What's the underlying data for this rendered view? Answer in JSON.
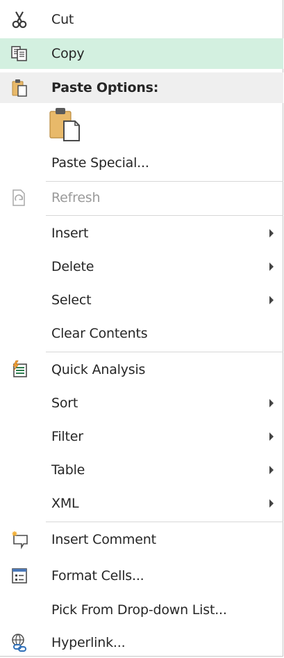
{
  "colors": {
    "text": "#262626",
    "disabled_text": "#9a9a9a",
    "hover_background": "#d3f0e0",
    "section_header_background": "#efefef",
    "separator": "#d7d7d7",
    "clipboard_gold": "#e8b96a"
  },
  "menu": {
    "cut": {
      "label": "Cut",
      "icon": "scissors-icon"
    },
    "copy": {
      "label": "Copy",
      "icon": "copy-icon"
    },
    "paste_options": {
      "label": "Paste Options:",
      "icon": "clipboard-icon"
    },
    "paste_button_icon": "paste-clipboard-icon",
    "paste_special": {
      "label": "Paste Special..."
    },
    "refresh": {
      "label": "Refresh",
      "icon": "refresh-icon",
      "disabled": true
    },
    "insert": {
      "label": "Insert",
      "has_submenu": true
    },
    "delete": {
      "label": "Delete",
      "has_submenu": true
    },
    "select": {
      "label": "Select",
      "has_submenu": true
    },
    "clear_contents": {
      "label": "Clear Contents"
    },
    "quick_analysis": {
      "label": "Quick Analysis",
      "icon": "quick-analysis-icon"
    },
    "sort": {
      "label": "Sort",
      "has_submenu": true
    },
    "filter": {
      "label": "Filter",
      "has_submenu": true
    },
    "table": {
      "label": "Table",
      "has_submenu": true
    },
    "xml": {
      "label": "XML",
      "has_submenu": true
    },
    "insert_comment": {
      "label": "Insert Comment",
      "icon": "comment-icon"
    },
    "format_cells": {
      "label": "Format Cells...",
      "icon": "format-cells-icon"
    },
    "pick_from_list": {
      "label": "Pick From Drop-down List..."
    },
    "hyperlink": {
      "label": "Hyperlink...",
      "icon": "hyperlink-icon"
    }
  }
}
